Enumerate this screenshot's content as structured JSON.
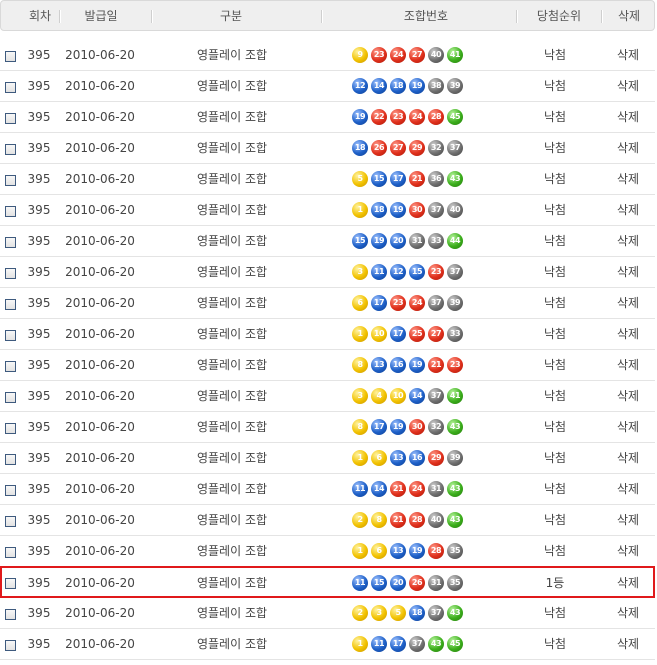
{
  "header": {
    "round": "회차",
    "date": "발급일",
    "type": "구분",
    "numbers": "조합번호",
    "rank": "당첨순위",
    "delete": "삭제"
  },
  "rows": [
    {
      "round": "395",
      "date": "2010-06-20",
      "type": "영플레이 조합",
      "numbers": [
        "9",
        "23",
        "24",
        "27",
        "40",
        "41"
      ],
      "rank": "낙첨",
      "delete": "삭제",
      "highlighted": false
    },
    {
      "round": "395",
      "date": "2010-06-20",
      "type": "영플레이 조합",
      "numbers": [
        "12",
        "14",
        "18",
        "19",
        "38",
        "39"
      ],
      "rank": "낙첨",
      "delete": "삭제",
      "highlighted": false
    },
    {
      "round": "395",
      "date": "2010-06-20",
      "type": "영플레이 조합",
      "numbers": [
        "19",
        "22",
        "23",
        "24",
        "28",
        "45"
      ],
      "rank": "낙첨",
      "delete": "삭제",
      "highlighted": false
    },
    {
      "round": "395",
      "date": "2010-06-20",
      "type": "영플레이 조합",
      "numbers": [
        "18",
        "26",
        "27",
        "29",
        "32",
        "37"
      ],
      "rank": "낙첨",
      "delete": "삭제",
      "highlighted": false
    },
    {
      "round": "395",
      "date": "2010-06-20",
      "type": "영플레이 조합",
      "numbers": [
        "5",
        "15",
        "17",
        "21",
        "36",
        "43"
      ],
      "rank": "낙첨",
      "delete": "삭제",
      "highlighted": false
    },
    {
      "round": "395",
      "date": "2010-06-20",
      "type": "영플레이 조합",
      "numbers": [
        "1",
        "18",
        "19",
        "30",
        "37",
        "40"
      ],
      "rank": "낙첨",
      "delete": "삭제",
      "highlighted": false
    },
    {
      "round": "395",
      "date": "2010-06-20",
      "type": "영플레이 조합",
      "numbers": [
        "15",
        "19",
        "20",
        "31",
        "33",
        "44"
      ],
      "rank": "낙첨",
      "delete": "삭제",
      "highlighted": false
    },
    {
      "round": "395",
      "date": "2010-06-20",
      "type": "영플레이 조합",
      "numbers": [
        "3",
        "11",
        "12",
        "15",
        "23",
        "37"
      ],
      "rank": "낙첨",
      "delete": "삭제",
      "highlighted": false
    },
    {
      "round": "395",
      "date": "2010-06-20",
      "type": "영플레이 조합",
      "numbers": [
        "6",
        "17",
        "23",
        "24",
        "37",
        "39"
      ],
      "rank": "낙첨",
      "delete": "삭제",
      "highlighted": false
    },
    {
      "round": "395",
      "date": "2010-06-20",
      "type": "영플레이 조합",
      "numbers": [
        "1",
        "10",
        "17",
        "25",
        "27",
        "33"
      ],
      "rank": "낙첨",
      "delete": "삭제",
      "highlighted": false
    },
    {
      "round": "395",
      "date": "2010-06-20",
      "type": "영플레이 조합",
      "numbers": [
        "8",
        "13",
        "16",
        "19",
        "21",
        "23"
      ],
      "rank": "낙첨",
      "delete": "삭제",
      "highlighted": false
    },
    {
      "round": "395",
      "date": "2010-06-20",
      "type": "영플레이 조합",
      "numbers": [
        "3",
        "4",
        "10",
        "14",
        "37",
        "41"
      ],
      "rank": "낙첨",
      "delete": "삭제",
      "highlighted": false
    },
    {
      "round": "395",
      "date": "2010-06-20",
      "type": "영플레이 조합",
      "numbers": [
        "8",
        "17",
        "19",
        "30",
        "32",
        "43"
      ],
      "rank": "낙첨",
      "delete": "삭제",
      "highlighted": false
    },
    {
      "round": "395",
      "date": "2010-06-20",
      "type": "영플레이 조합",
      "numbers": [
        "1",
        "6",
        "13",
        "16",
        "29",
        "39"
      ],
      "rank": "낙첨",
      "delete": "삭제",
      "highlighted": false
    },
    {
      "round": "395",
      "date": "2010-06-20",
      "type": "영플레이 조합",
      "numbers": [
        "11",
        "14",
        "21",
        "24",
        "31",
        "43"
      ],
      "rank": "낙첨",
      "delete": "삭제",
      "highlighted": false
    },
    {
      "round": "395",
      "date": "2010-06-20",
      "type": "영플레이 조합",
      "numbers": [
        "2",
        "8",
        "21",
        "28",
        "40",
        "43"
      ],
      "rank": "낙첨",
      "delete": "삭제",
      "highlighted": false
    },
    {
      "round": "395",
      "date": "2010-06-20",
      "type": "영플레이 조합",
      "numbers": [
        "1",
        "6",
        "13",
        "19",
        "28",
        "35"
      ],
      "rank": "낙첨",
      "delete": "삭제",
      "highlighted": false
    },
    {
      "round": "395",
      "date": "2010-06-20",
      "type": "영플레이 조합",
      "numbers": [
        "11",
        "15",
        "20",
        "26",
        "31",
        "35"
      ],
      "rank": "1등",
      "delete": "삭제",
      "highlighted": true
    },
    {
      "round": "395",
      "date": "2010-06-20",
      "type": "영플레이 조합",
      "numbers": [
        "2",
        "3",
        "5",
        "18",
        "37",
        "43"
      ],
      "rank": "낙첨",
      "delete": "삭제",
      "highlighted": false
    },
    {
      "round": "395",
      "date": "2010-06-20",
      "type": "영플레이 조합",
      "numbers": [
        "1",
        "11",
        "17",
        "37",
        "43",
        "45"
      ],
      "rank": "낙첨",
      "delete": "삭제",
      "highlighted": false
    }
  ],
  "colors": {
    "highlight_border": "#e0191b",
    "ball_1_10": "#f2c200",
    "ball_11_20": "#1e60c8",
    "ball_21_30": "#e0301c",
    "ball_31_40": "#707070",
    "ball_41_45": "#3cae1c"
  }
}
